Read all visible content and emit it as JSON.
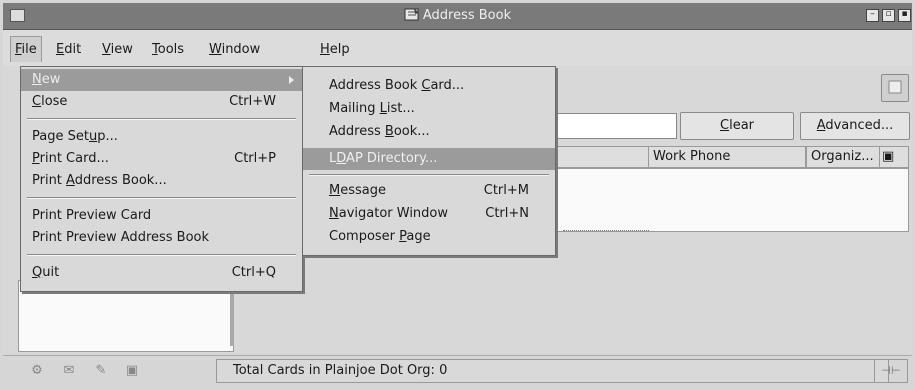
{
  "window": {
    "title": "Address Book"
  },
  "menubar": [
    {
      "label": "File",
      "u": "F",
      "rest": "ile"
    },
    {
      "label": "Edit",
      "u": "E",
      "rest": "dit"
    },
    {
      "label": "View",
      "u": "V",
      "rest": "iew"
    },
    {
      "label": "Tools",
      "u": "T",
      "rest": "ools"
    },
    {
      "label": "Window",
      "u": "W",
      "rest": "indow"
    },
    {
      "label": "Help",
      "u": "H",
      "rest": "elp"
    }
  ],
  "file_menu": {
    "new": {
      "u": "N",
      "rest": "ew"
    },
    "close": {
      "u": "C",
      "rest": "lose",
      "shortcut": "Ctrl+W"
    },
    "page_setup": {
      "pre": "Page Set",
      "u": "u",
      "rest": "p..."
    },
    "print_card": {
      "u": "P",
      "rest": "rint Card...",
      "shortcut": "Ctrl+P"
    },
    "print_address_book": {
      "pre": "Print ",
      "u": "A",
      "rest": "ddress Book..."
    },
    "print_preview_card": "Print Preview Card",
    "print_preview_address_book": "Print Preview Address Book",
    "quit": {
      "u": "Q",
      "rest": "uit",
      "shortcut": "Ctrl+Q"
    }
  },
  "new_submenu": {
    "address_book_card": {
      "pre": "Address Book ",
      "u": "C",
      "rest": "ard..."
    },
    "mailing_list": {
      "pre": "Mailing ",
      "u": "L",
      "rest": "ist..."
    },
    "address_book": {
      "pre": "Address ",
      "u": "B",
      "rest": "ook..."
    },
    "ldap_directory": {
      "pre": "L",
      "u": "D",
      "rest": "AP Directory..."
    },
    "message": {
      "u": "M",
      "rest": "essage",
      "shortcut": "Ctrl+M"
    },
    "navigator_window": {
      "u": "N",
      "rest": "avigator Window",
      "shortcut": "Ctrl+N"
    },
    "composer_page": {
      "pre": "Composer ",
      "u": "P",
      "rest": "age"
    }
  },
  "toolbar": {
    "clear": {
      "u": "C",
      "rest": "lear"
    },
    "advanced": {
      "u": "A",
      "rest": "dvanced..."
    }
  },
  "columns": [
    "Work Phone",
    "Organiz..."
  ],
  "status": {
    "text": "Total Cards in Plainjoe Dot Org: 0"
  }
}
